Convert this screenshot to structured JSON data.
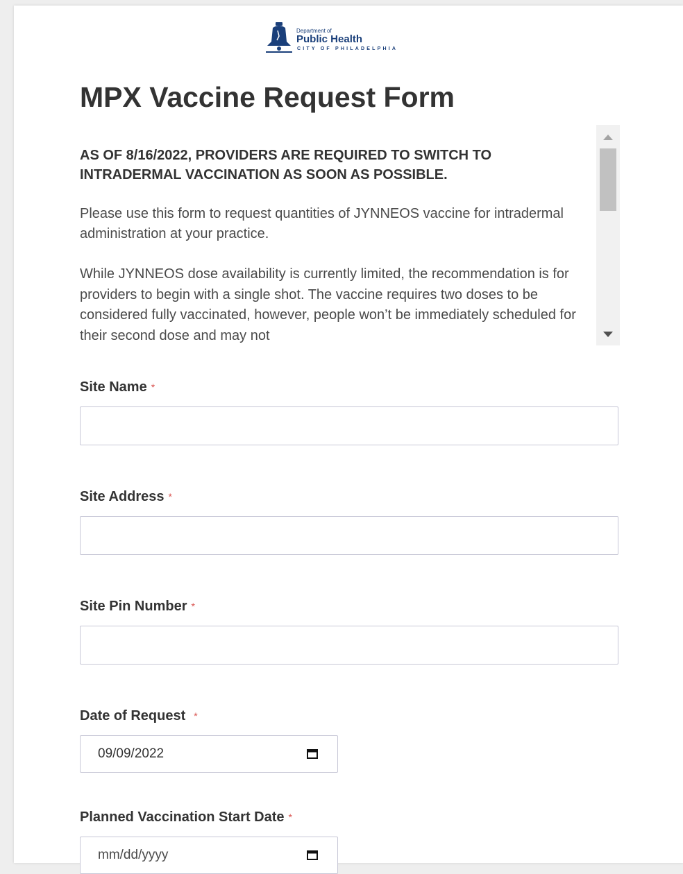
{
  "logo": {
    "line1": "Department of",
    "line2": "Public Health",
    "line3": "CITY OF PHILADELPHIA",
    "icon": "liberty-bell-icon"
  },
  "form": {
    "title": "MPX Vaccine Request Form",
    "description": {
      "heading": "AS OF 8/16/2022, PROVIDERS ARE REQUIRED TO SWITCH TO INTRADERMAL VACCINATION AS SOON AS POSSIBLE.",
      "paragraph1": "Please use this form to request quantities of JYNNEOS vaccine for intradermal administration at your practice.",
      "paragraph2": "While JYNNEOS dose availability is currently limited, the recommendation is for providers to begin with a single shot. The vaccine requires two doses to be considered fully vaccinated, however, people won’t be immediately scheduled for their second dose and may not"
    },
    "required_marker": "*",
    "fields": {
      "site_name": {
        "label": "Site Name",
        "value": ""
      },
      "site_address": {
        "label": "Site Address",
        "value": ""
      },
      "site_pin": {
        "label": "Site Pin Number",
        "value": ""
      },
      "date_of_request": {
        "label": "Date of Request",
        "value": "09/09/2022"
      },
      "planned_start": {
        "label": "Planned Vaccination Start Date",
        "placeholder": "mm/dd/yyyy"
      }
    }
  },
  "colors": {
    "brand_blue": "#1a3f7a",
    "required_red": "#d9534f",
    "input_border": "#c7c7d6"
  }
}
